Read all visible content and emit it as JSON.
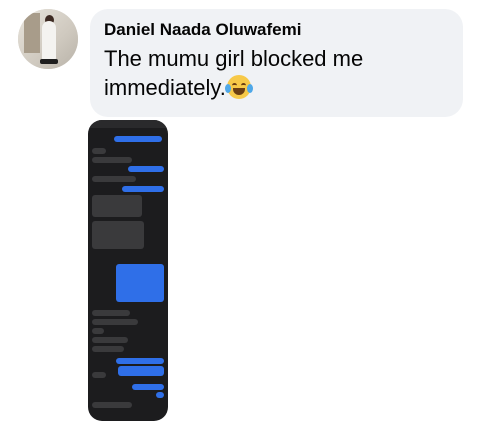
{
  "comment": {
    "author": "Daniel Naada Oluwafemi",
    "text": "The mumu girl blocked me immediately.",
    "emoji_icon": "face-with-tears-of-joy-icon"
  },
  "screenshot": {
    "theme_colors": {
      "background": "#1c1c1e",
      "incoming": "#3a3a3c",
      "outgoing": "#2f6fe8"
    }
  }
}
